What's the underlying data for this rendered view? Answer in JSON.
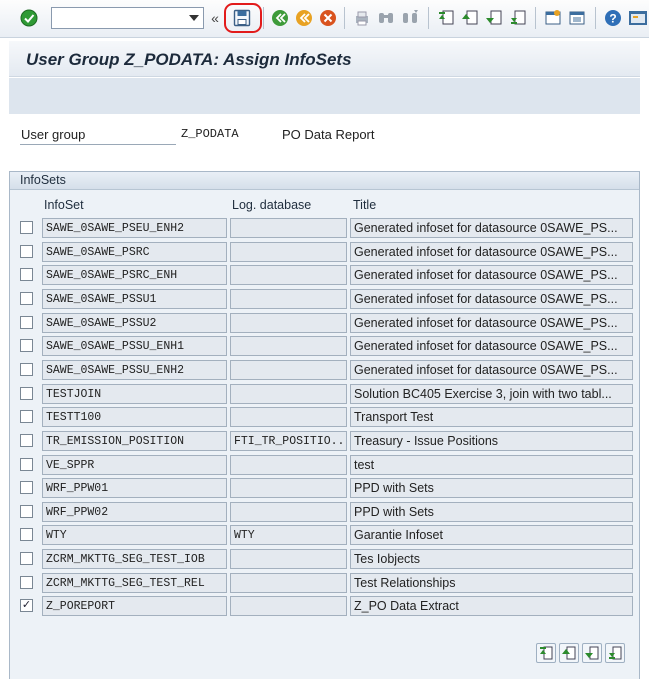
{
  "screen": {
    "title": "User Group Z_PODATA: Assign InfoSets"
  },
  "toolbar": {
    "command_field_value": "",
    "icons": [
      "enter-icon",
      "back-icon",
      "exit-icon",
      "cancel-icon",
      "print-icon",
      "find-icon",
      "find-next-icon",
      "first-page-icon",
      "previous-page-icon",
      "next-page-icon",
      "last-page-icon",
      "create-session-icon",
      "shortcut-icon",
      "help-icon",
      "customize-icon"
    ],
    "save_highlight_color": "#e21b1b"
  },
  "header": {
    "user_group_label": "User group",
    "user_group_value": "Z_PODATA",
    "user_group_desc": "PO Data Report"
  },
  "infosets": {
    "group_title": "InfoSets",
    "columns": [
      "InfoSet",
      "Log. database",
      "Title"
    ],
    "rows": [
      {
        "checked": false,
        "infoset": "SAWE_0SAWE_PSEU_ENH2",
        "logdb": "",
        "title": "Generated infoset for datasource 0SAWE_PS..."
      },
      {
        "checked": false,
        "infoset": "SAWE_0SAWE_PSRC",
        "logdb": "",
        "title": "Generated infoset for datasource 0SAWE_PS..."
      },
      {
        "checked": false,
        "infoset": "SAWE_0SAWE_PSRC_ENH",
        "logdb": "",
        "title": "Generated infoset for datasource 0SAWE_PS..."
      },
      {
        "checked": false,
        "infoset": "SAWE_0SAWE_PSSU1",
        "logdb": "",
        "title": "Generated infoset for datasource 0SAWE_PS..."
      },
      {
        "checked": false,
        "infoset": "SAWE_0SAWE_PSSU2",
        "logdb": "",
        "title": "Generated infoset for datasource 0SAWE_PS..."
      },
      {
        "checked": false,
        "infoset": "SAWE_0SAWE_PSSU_ENH1",
        "logdb": "",
        "title": "Generated infoset for datasource 0SAWE_PS..."
      },
      {
        "checked": false,
        "infoset": "SAWE_0SAWE_PSSU_ENH2",
        "logdb": "",
        "title": "Generated infoset for datasource 0SAWE_PS..."
      },
      {
        "checked": false,
        "infoset": "TESTJOIN",
        "logdb": "",
        "title": "Solution BC405 Exercise 3, join with two tabl..."
      },
      {
        "checked": false,
        "infoset": "TESTT100",
        "logdb": "",
        "title": "Transport Test"
      },
      {
        "checked": false,
        "infoset": "TR_EMISSION_POSITION",
        "logdb": "FTI_TR_POSITIO...",
        "title": "Treasury - Issue Positions"
      },
      {
        "checked": false,
        "infoset": "VE_SPPR",
        "logdb": "",
        "title": "test"
      },
      {
        "checked": false,
        "infoset": "WRF_PPW01",
        "logdb": "",
        "title": "PPD with Sets"
      },
      {
        "checked": false,
        "infoset": "WRF_PPW02",
        "logdb": "",
        "title": "PPD with Sets"
      },
      {
        "checked": false,
        "infoset": "WTY",
        "logdb": "WTY",
        "title": "Garantie Infoset"
      },
      {
        "checked": false,
        "infoset": "ZCRM_MKTTG_SEG_TEST_IOB",
        "logdb": "",
        "title": "Tes Iobjects"
      },
      {
        "checked": false,
        "infoset": "ZCRM_MKTTG_SEG_TEST_REL",
        "logdb": "",
        "title": "Test Relationships"
      },
      {
        "checked": true,
        "infoset": "Z_POREPORT",
        "logdb": "",
        "title": "Z_PO Data Extract"
      }
    ],
    "scroll_buttons": [
      "first-page-icon",
      "previous-page-icon",
      "next-page-icon",
      "last-page-icon"
    ]
  }
}
